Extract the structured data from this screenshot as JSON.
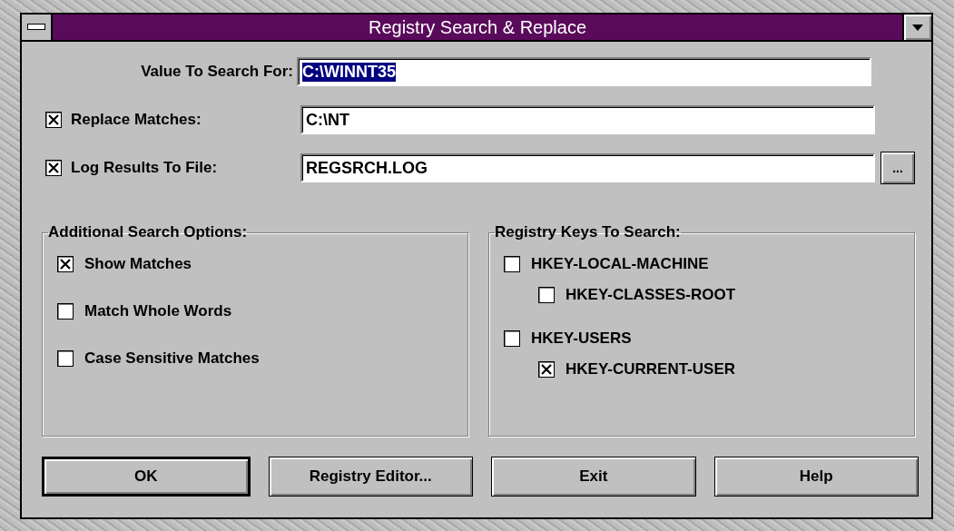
{
  "window": {
    "title": "Registry Search & Replace"
  },
  "fields": [
    {
      "kind": "plain",
      "label": "Value To Search For:",
      "value": "C:\\WINNT35",
      "value_selected": true
    },
    {
      "kind": "checkbox",
      "checked": true,
      "label": "Replace Matches:",
      "value": "C:\\NT",
      "value_selected": false
    },
    {
      "kind": "checkbox",
      "checked": true,
      "label": "Log Results To File:",
      "value": "REGSRCH.LOG",
      "value_selected": false,
      "browse": "..."
    }
  ],
  "search_options": {
    "title": "Additional Search Options:",
    "items": [
      {
        "label": "Show Matches",
        "checked": true
      },
      {
        "label": "Match Whole Words",
        "checked": false
      },
      {
        "label": "Case Sensitive Matches",
        "checked": false
      }
    ]
  },
  "registry_keys": {
    "title": "Registry Keys To Search:",
    "items": [
      {
        "label": "HKEY-LOCAL-MACHINE",
        "checked": false,
        "children": [
          {
            "label": "HKEY-CLASSES-ROOT",
            "checked": false
          }
        ]
      },
      {
        "label": "HKEY-USERS",
        "checked": false,
        "children": [
          {
            "label": "HKEY-CURRENT-USER",
            "checked": true
          }
        ]
      }
    ]
  },
  "buttons": [
    {
      "label": "OK",
      "default": true
    },
    {
      "label": "Registry Editor...",
      "default": false
    },
    {
      "label": "Exit",
      "default": false
    },
    {
      "label": "Help",
      "default": false
    }
  ]
}
